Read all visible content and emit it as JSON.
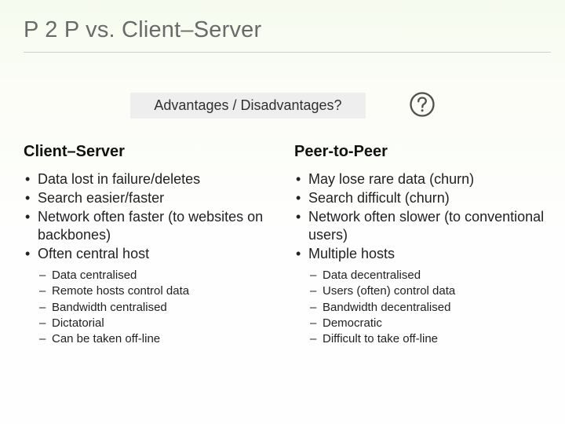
{
  "title": "P 2 P vs. Client–Server",
  "question": "Advantages / Disadvantages?",
  "columns": {
    "left": {
      "heading": "Client–Server",
      "bullets": [
        "Data lost in failure/deletes",
        "Search easier/faster",
        "Network often faster (to websites on backbones)",
        "Often central host"
      ],
      "sub_bullets": [
        "Data centralised",
        "Remote hosts control data",
        "Bandwidth centralised",
        "Dictatorial",
        "Can be taken off-line"
      ]
    },
    "right": {
      "heading": "Peer-to-Peer",
      "bullets": [
        "May lose rare data (churn)",
        "Search difficult (churn)",
        "Network often slower (to conventional users)",
        "Multiple hosts"
      ],
      "sub_bullets": [
        "Data decentralised",
        "Users (often) control data",
        "Bandwidth decentralised",
        "Democratic",
        "Difficult to take off-line"
      ]
    }
  }
}
